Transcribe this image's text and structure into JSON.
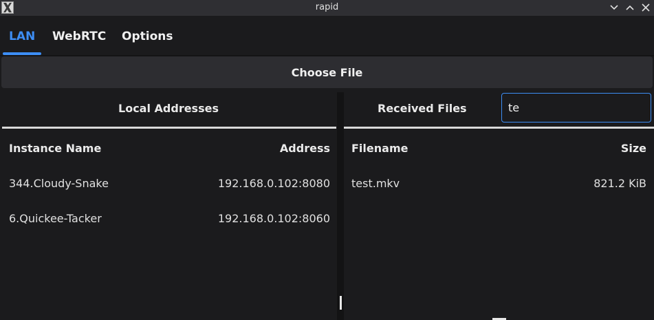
{
  "window": {
    "title": "rapid"
  },
  "tabs": [
    {
      "label": "LAN"
    },
    {
      "label": "WebRTC"
    },
    {
      "label": "Options"
    }
  ],
  "choose_file": {
    "label": "Choose File"
  },
  "local": {
    "title": "Local Addresses",
    "columns": [
      "Instance Name",
      "Address"
    ],
    "rows": [
      {
        "name": "344.Cloudy-Snake",
        "address": "192.168.0.102:8080"
      },
      {
        "name": "6.Quickee-Tacker",
        "address": "192.168.0.102:8060"
      }
    ]
  },
  "received": {
    "title": "Received Files",
    "search_value": "te",
    "columns": [
      "Filename",
      "Size"
    ],
    "rows": [
      {
        "filename": "test.mkv",
        "size": "821.2 KiB"
      }
    ]
  },
  "colors": {
    "accent": "#3d8ef5",
    "background": "#1b1b1d",
    "button": "#2d2d31"
  },
  "icons": {
    "app": "x-logo-icon",
    "minimize": "chevron-down-icon",
    "maximize": "chevron-up-icon",
    "close": "close-icon"
  }
}
